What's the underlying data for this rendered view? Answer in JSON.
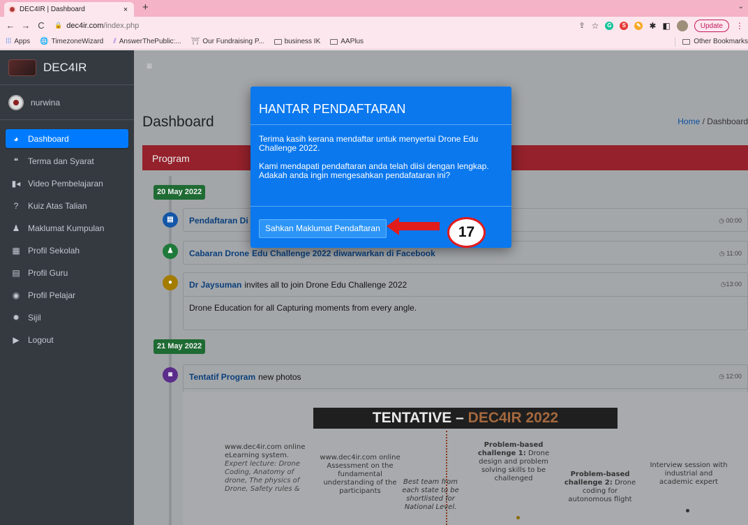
{
  "browser": {
    "tab_title": "DEC4IR | Dashboard",
    "tab_close": "×",
    "new_tab": "+",
    "url_host": "dec4ir.com",
    "url_path": "/index.php",
    "update_label": "Update",
    "bookmarks": [
      "Apps",
      "TimezoneWizard",
      "AnswerThePublic:...",
      "Our Fundraising P...",
      "business IK",
      "AAPlus"
    ],
    "other_bookmarks": "Other Bookmarks"
  },
  "sidebar": {
    "brand": "DEC4IR",
    "user": "nurwina",
    "items": [
      {
        "label": "Dashboard",
        "icon": "dashboard-icon"
      },
      {
        "label": "Terma dan Syarat",
        "icon": "quote-icon"
      },
      {
        "label": "Video Pembelajaran",
        "icon": "video-icon"
      },
      {
        "label": "Kuiz Atas Talian",
        "icon": "question-icon"
      },
      {
        "label": "Maklumat Kumpulan",
        "icon": "group-icon"
      },
      {
        "label": "Profil Sekolah",
        "icon": "building-icon"
      },
      {
        "label": "Profil Guru",
        "icon": "id-card-icon"
      },
      {
        "label": "Profil Pelajar",
        "icon": "user-circle-icon"
      },
      {
        "label": "Sijil",
        "icon": "certificate-icon"
      },
      {
        "label": "Logout",
        "icon": "logout-icon"
      }
    ]
  },
  "main": {
    "title": "Dashboard",
    "breadcrumb_home": "Home",
    "breadcrumb_sep": "/",
    "breadcrumb_current": "Dashboard",
    "section": "Program",
    "dates": [
      "20 May 2022",
      "21 May 2022"
    ],
    "posts": [
      {
        "link": "Pendaftaran Di",
        "rest": "",
        "time": "00:00"
      },
      {
        "link": "Cabaran Drone",
        "rest": "Edu Challenge 2022 diwarwarkan di Facebook",
        "time": "11:00"
      },
      {
        "link": "Dr Jaysuman",
        "rest": "invites all to join Drone Edu Challenge 2022",
        "time": "13:00",
        "body": "Drone Education for all Capturing moments from every angle."
      },
      {
        "link": "Tentatif Program",
        "rest": "new photos",
        "time": "12:00"
      }
    ],
    "tentative": {
      "title_a": "TENTATIVE – ",
      "title_b": "DEC4IR 2022",
      "col1": "www.dec4ir.com online eLearning system.",
      "col1_italic": "Expert lecture: Drone Coding, Anatomy of drone, The physics of Drone, Safety rules &",
      "col2": "www.dec4ir.com online Assessment on the fundamental understanding of the participants",
      "col3": "Best team from each state to be shortlisted for National Level.",
      "col4_a": "Problem-based challenge 1:",
      "col4_b": "Drone design and problem solving skills to be challenged",
      "col5_a": "Problem-based challenge 2:",
      "col5_b": "Drone coding for autonomous flight",
      "col6": "Interview session with industrial and academic expert"
    }
  },
  "modal": {
    "title": "HANTAR PENDAFTARAN",
    "p1": "Terima kasih kerana mendaftar untuk menyertai Drone Edu Challenge 2022.",
    "p2": "Kami mendapati pendaftaran anda telah diisi dengan lengkap. Adakah anda ingin mengesahkan pendafataran ini?",
    "button": "Sahkan Maklumat Pendaftaran"
  },
  "annotation": {
    "step": "17",
    "color": "#e21b1b"
  }
}
